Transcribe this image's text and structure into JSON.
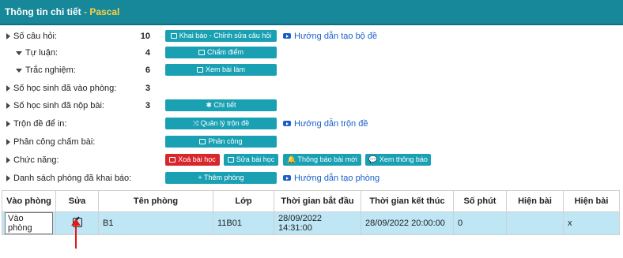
{
  "header": {
    "title": "Thông tin chi tiết",
    "sep": " - ",
    "subject": "Pascal"
  },
  "rows": {
    "questions": {
      "label": "Số câu hỏi:",
      "value": "10",
      "button": "Khai báo - Chỉnh sửa câu hỏi",
      "link": "Hướng dẫn tạo bộ đề"
    },
    "essay": {
      "label": "Tự luận:",
      "value": "4",
      "button": "Chấm điểm"
    },
    "mcq": {
      "label": "Trắc nghiệm:",
      "value": "6",
      "button": "Xem bài làm"
    },
    "entered": {
      "label": "Số học sinh đã vào phòng:",
      "value": "3"
    },
    "submitted": {
      "label": "Số học sinh đã nộp bài:",
      "value": "3",
      "button": "Chi tiết"
    },
    "mix": {
      "label": "Trộn đề để in:",
      "button": "Quản lý trộn đề",
      "link": "Hướng dẫn trộn đề"
    },
    "assign": {
      "label": "Phân công chấm bài:",
      "button": "Phân công"
    },
    "functions": {
      "label": "Chức năng:",
      "delete": "Xoá bài học",
      "edit": "Sửa bài học",
      "notify": "Thông báo bài mới",
      "view_notice": "Xem thông báo"
    },
    "rooms": {
      "label": "Danh sách phòng đã khai báo:",
      "button": "+ Thêm phòng",
      "link": "Hướng dẫn tạo phòng"
    }
  },
  "table": {
    "headers": [
      "Vào phòng",
      "Sửa",
      "Tên phòng",
      "Lớp",
      "Thời gian bắt đầu",
      "Thời gian kết thúc",
      "Số phút",
      "Hiện bài",
      "Hiện bài"
    ],
    "row": {
      "enter": "Vào phòng",
      "room": "B1",
      "class": "11B01",
      "start": "28/09/2022 14:31:00",
      "end": "28/09/2022 20:00:00",
      "minutes": "0",
      "show2": "x"
    }
  },
  "colors": {
    "accent": "#17879a",
    "button": "#1aa0b3",
    "danger": "#d9262b",
    "link": "#1a5fc9",
    "selected_row": "#bfe6f5",
    "arrow": "#e01818"
  },
  "icons": [
    "edit-icon",
    "youtube-icon",
    "pencil-square-icon",
    "arrow-up-icon"
  ]
}
